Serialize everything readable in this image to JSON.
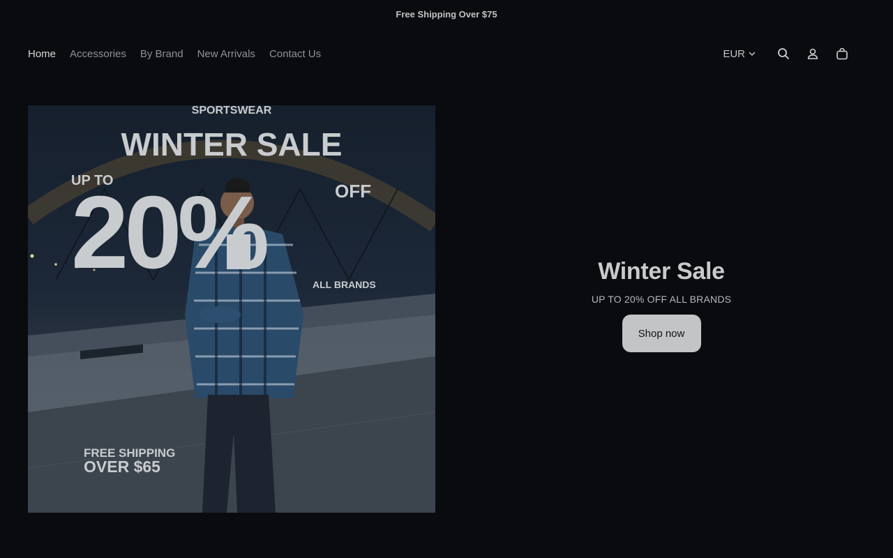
{
  "announcement": {
    "text": "Free Shipping Over $75"
  },
  "nav": {
    "items": [
      {
        "label": "Home"
      },
      {
        "label": "Accessories"
      },
      {
        "label": "By Brand"
      },
      {
        "label": "New Arrivals"
      },
      {
        "label": "Contact Us"
      }
    ]
  },
  "header_tools": {
    "currency": "EUR",
    "icons": [
      "search-icon",
      "account-icon",
      "cart-icon"
    ]
  },
  "hero_image": {
    "brand_mark": "SPORTSWEAR",
    "headline": "WINTER SALE",
    "up_to": "UP TO",
    "percent": "20%",
    "off": "OFF",
    "all_brands": "ALL BRANDS",
    "shipping_line1": "FREE SHIPPING",
    "shipping_line2": "OVER $65"
  },
  "promo": {
    "title": "Winter Sale",
    "subtitle": "UP TO 20% OFF ALL BRANDS",
    "button": "Shop now"
  },
  "colors": {
    "background": "#090b0e",
    "button_bg": "#c3c4c6",
    "text_muted": "#8e9296"
  }
}
